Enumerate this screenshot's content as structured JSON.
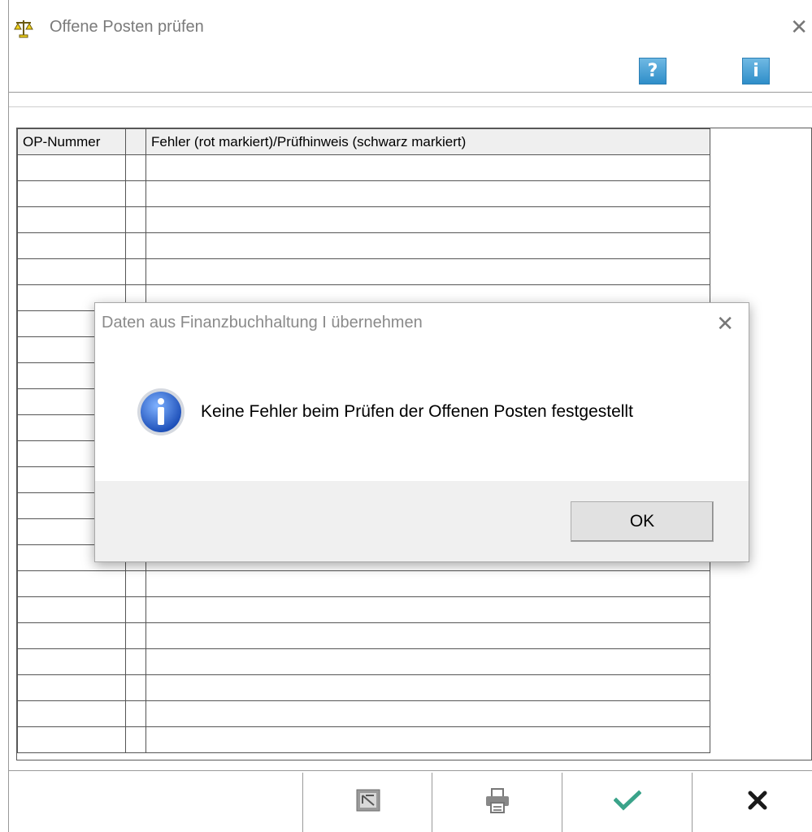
{
  "window": {
    "title": "Offene Posten prüfen",
    "close_symbol": "✕"
  },
  "toolbar": {
    "help_label": "?",
    "info_label": "i"
  },
  "grid": {
    "headers": [
      "OP-Nummer",
      "",
      "Fehler (rot markiert)/Prüfhinweis (schwarz markiert)"
    ],
    "row_count": 23
  },
  "bottom_buttons": [
    {
      "icon": "export-icon"
    },
    {
      "icon": "print-icon"
    },
    {
      "icon": "check-icon",
      "color": "#3aa38a"
    },
    {
      "icon": "close-icon"
    }
  ],
  "dialog": {
    "title": "Daten aus Finanzbuchhaltung I übernehmen",
    "close_symbol": "✕",
    "message": "Keine Fehler beim Prüfen der Offenen Posten festgestellt",
    "ok_label": "OK",
    "icon": "info-icon"
  },
  "colors": {
    "accent_blue": "#2f8ec9",
    "check_green": "#3aa38a"
  }
}
